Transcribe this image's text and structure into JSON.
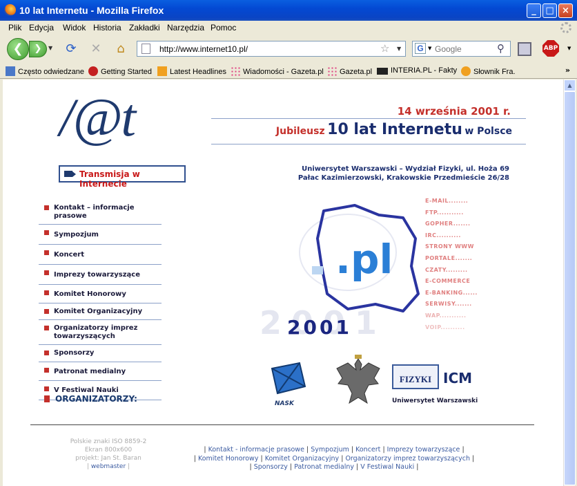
{
  "window": {
    "title": "10 lat Internetu - Mozilla Firefox"
  },
  "menu": [
    "Plik",
    "Edycja",
    "Widok",
    "Historia",
    "Zakładki",
    "Narzędzia",
    "Pomoc"
  ],
  "address": {
    "url": "http://www.internet10.pl/"
  },
  "search": {
    "placeholder": "Google"
  },
  "addon": {
    "abp_label": "ABP"
  },
  "bookmarks": [
    "Często odwiedzane",
    "Getting Started",
    "Latest Headlines",
    "Wiadomości - Gazeta.pl",
    "Gazeta.pl",
    "INTERIA.PL - Fakty",
    "Słownik Fra."
  ],
  "page": {
    "logo": "/@t",
    "date": "14 września 2001 r.",
    "jubilee_1": "Jubileusz",
    "jubilee_2": "10 lat Internetu",
    "jubilee_3": "w Polsce",
    "transmission": "Transmisja w Internecie",
    "venue_1": "Uniwersytet Warszawski – Wydział Fizyki, ul. Hoża 69",
    "venue_2": "Pałac Kazimierzowski, Krakowskie Przedmieście 26/28",
    "nav": [
      "Kontakt – informacje prasowe",
      "Sympozjum",
      "Koncert",
      "Imprezy towarzyszące",
      "Komitet Honorowy",
      "Komitet Organizacyjny",
      "Organizatorzy imprez towarzyszących",
      "Sponsorzy",
      "Patronat medialny",
      "V Festiwal Nauki"
    ],
    "organizers": "ORGANIZATORZY:",
    "map_text": ".pl",
    "year": "2001",
    "services": [
      "E-MAIL",
      "FTP",
      "GOPHER",
      "IRC",
      "STRONY WWW",
      "PORTALE",
      "CZATY",
      "E-COMMERCE",
      "E-BANKING",
      "SERWISY",
      "WAP",
      "VOIP"
    ],
    "nask_label": "NASK",
    "fizyki_label": "FIZYKI",
    "icm_label": "ICM",
    "uw_label": "Uniwersytet Warszawski"
  },
  "footer": {
    "info_1": "Polskie znaki ISO 8859-2",
    "info_2": "Ekran 800x600",
    "info_3": "projekt: Jan St. Baran",
    "webmaster": "webmaster",
    "links": [
      "Kontakt - informacje prasowe",
      "Sympozjum",
      "Koncert",
      "Imprezy towarzyszące",
      "Komitet Honorowy",
      "Komitet Organizacyjny",
      "Organizatorzy imprez towarzyszących",
      "Sponsorzy",
      "Patronat medialny",
      "V Festiwal Nauki"
    ]
  }
}
